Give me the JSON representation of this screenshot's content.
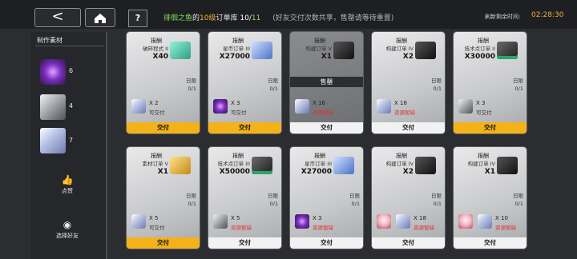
{
  "header": {
    "back": "<",
    "help": "?",
    "title_owner": "徘徊之鱼",
    "title_connector": "的",
    "title_level": "10级",
    "title_suffix": "订单库",
    "progress_current": "10",
    "progress_sep": "/",
    "progress_total": "11",
    "note": "(好友交付次数共享，售罄请等待重置)",
    "refresh_label": "刷新剩余时间:",
    "refresh_time": "02:28:30"
  },
  "sidebar": {
    "heading": "制作素材",
    "materials": [
      {
        "icon": "purple-orb-icon",
        "count": "6"
      },
      {
        "icon": "silver-plate-icon",
        "count": "4"
      },
      {
        "icon": "crystal-cube-icon",
        "count": "7"
      }
    ],
    "like_label": "点赞",
    "select_friend_label": "选择好友"
  },
  "cards": [
    {
      "ret_label": "报酬",
      "ret_name": "破碎程式 II",
      "ret_qty": "X40",
      "ret_icon": "teal-chip-icon",
      "limit_label": "日限",
      "limit": "0/1",
      "req_icon": "crystal-cube-icon",
      "req_qty": "X 2",
      "req_status": "可交付",
      "btn": "交付",
      "ready": true
    },
    {
      "ret_label": "报酬",
      "ret_name": "星币订单 III",
      "ret_qty": "X27000",
      "ret_icon": "blue-gem-icon",
      "limit_label": "日限",
      "limit": "0/1",
      "req_icon": "purple-orb-icon",
      "req_qty": "X 3",
      "req_status": "可交付",
      "btn": "交付",
      "ready": true
    },
    {
      "ret_label": "报酬",
      "ret_name": "构建订单 V",
      "ret_qty": "X1",
      "ret_icon": "dark-ticket-icon",
      "soldout": "售罄",
      "req_icon": "crystal-cube-icon",
      "req_qty": "X 16",
      "req_status": "资源暂缺",
      "btn": "交付",
      "ready": false,
      "dim": true
    },
    {
      "ret_label": "报酬",
      "ret_name": "构建订单 IV",
      "ret_qty": "X2",
      "ret_icon": "dark-ticket-icon",
      "limit_label": "日限",
      "limit": "0/1",
      "req_icon": "crystal-cube-icon",
      "req_qty": "X 18",
      "req_status": "资源暂缺",
      "btn": "交付",
      "ready": false
    },
    {
      "ret_label": "报酬",
      "ret_name": "技术点订单 II",
      "ret_qty": "X30000",
      "ret_icon": "exp-chip-icon",
      "limit_label": "日限",
      "limit": "0/1",
      "req_icon": "silver-plate-icon",
      "req_qty": "X 3",
      "req_status": "可交付",
      "btn": "交付",
      "ready": true
    },
    {
      "ret_label": "报酬",
      "ret_name": "素材订单 V",
      "ret_qty": "X1",
      "ret_icon": "gold-bars-icon",
      "limit_label": "日限",
      "limit": "0/1",
      "req_icon": "crystal-cube-icon",
      "req_qty": "X 5",
      "req_status": "可交付",
      "btn": "交付",
      "ready": true
    },
    {
      "ret_label": "报酬",
      "ret_name": "技术点订单 III",
      "ret_qty": "X50000",
      "ret_icon": "exp-chip-icon",
      "limit_label": "日限",
      "limit": "0/1",
      "req_icon": "silver-plate-icon",
      "req_qty": "X 5",
      "req_status": "资源暂缺",
      "btn": "交付",
      "ready": false
    },
    {
      "ret_label": "报酬",
      "ret_name": "星币订单 III",
      "ret_qty": "X27000",
      "ret_icon": "blue-gem-icon",
      "limit_label": "日限",
      "limit": "0/1",
      "req_icon": "purple-orb-icon",
      "req_qty": "X 3",
      "req_status": "资源暂缺",
      "btn": "交付",
      "ready": false
    },
    {
      "ret_label": "报酬",
      "ret_name": "构建订单 IV",
      "ret_qty": "X2",
      "ret_icon": "dark-ticket-icon",
      "limit_label": "日限",
      "limit": "0/1",
      "req_icon": "crystal-cube-icon",
      "req_qty": "X 18",
      "req_status": "资源暂缺",
      "btn": "交付",
      "ready": false,
      "avatar": true
    },
    {
      "ret_label": "报酬",
      "ret_name": "构建订单 IV",
      "ret_qty": "X1",
      "ret_icon": "dark-ticket-icon",
      "limit_label": "日限",
      "limit": "0/1",
      "req_icon": "crystal-cube-icon",
      "req_qty": "X 10",
      "req_status": "资源暂缺",
      "btn": "交付",
      "ready": false,
      "avatar": true
    }
  ]
}
